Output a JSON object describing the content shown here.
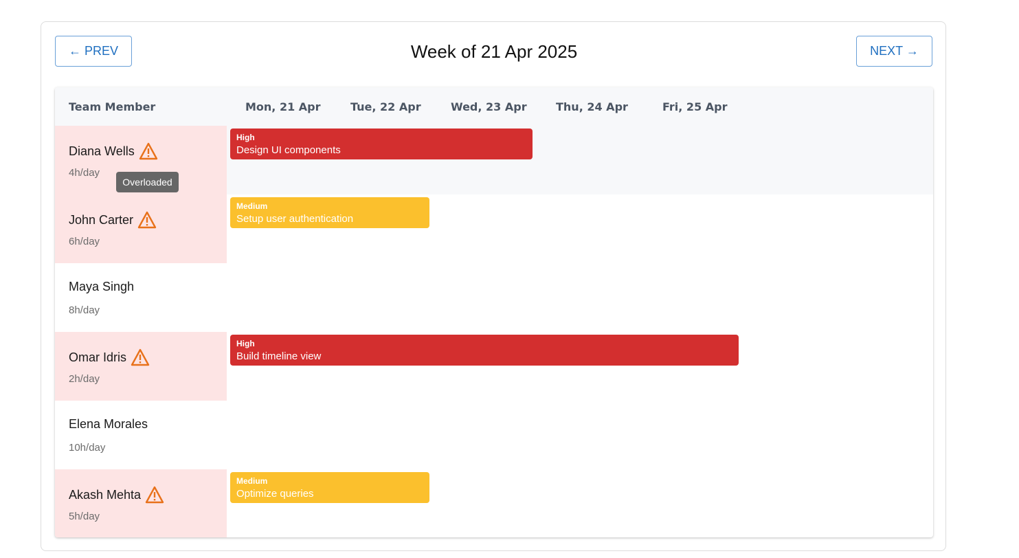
{
  "nav": {
    "prev_label": "← PREV",
    "next_label": "NEXT →"
  },
  "week_title": "Week of 21 Apr 2025",
  "header": {
    "member_col": "Team Member",
    "days": [
      "Mon, 21 Apr",
      "Tue, 22 Apr",
      "Wed, 23 Apr",
      "Thu, 24 Apr",
      "Fri, 25 Apr"
    ]
  },
  "members": [
    {
      "name": "Diana Wells",
      "hours": "4h/day",
      "overloaded": true,
      "tasks": [
        {
          "priority": "High",
          "title": "Design UI components",
          "start_day": 0,
          "span_days": 3
        }
      ]
    },
    {
      "name": "John Carter",
      "hours": "6h/day",
      "overloaded": true,
      "tasks": [
        {
          "priority": "Medium",
          "title": "Setup user authentication",
          "start_day": 0,
          "span_days": 2
        }
      ]
    },
    {
      "name": "Maya Singh",
      "hours": "8h/day",
      "overloaded": false,
      "tasks": []
    },
    {
      "name": "Omar Idris",
      "hours": "2h/day",
      "overloaded": true,
      "tasks": [
        {
          "priority": "High",
          "title": "Build timeline view",
          "start_day": 0,
          "span_days": 5
        }
      ]
    },
    {
      "name": "Elena Morales",
      "hours": "10h/day",
      "overloaded": false,
      "tasks": []
    },
    {
      "name": "Akash Mehta",
      "hours": "5h/day",
      "overloaded": true,
      "tasks": [
        {
          "priority": "Medium",
          "title": "Optimize queries",
          "start_day": 0,
          "span_days": 2
        }
      ]
    }
  ],
  "tooltip": {
    "text": "Overloaded"
  },
  "colors": {
    "high": "#d32f2f",
    "medium": "#fbc02d",
    "overloaded_bg": "#fde4e4",
    "warning_icon": "#e8711a",
    "accent": "#1f6fc0"
  },
  "icons": {
    "warning": "warning-triangle-icon"
  }
}
